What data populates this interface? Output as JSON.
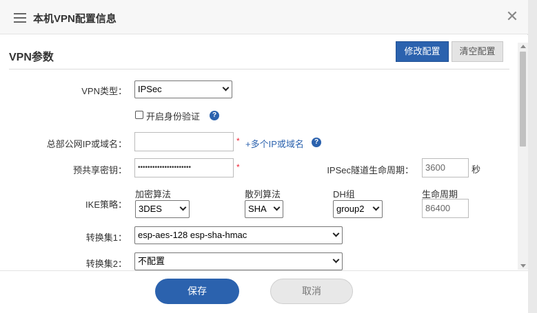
{
  "dialog": {
    "title": "本机VPN配置信息",
    "close_glyph": "✕"
  },
  "section": {
    "title": "VPN参数",
    "modify_label": "修改配置",
    "clear_label": "清空配置"
  },
  "form": {
    "vpn_type_label": "VPN类型：",
    "vpn_type_value": "IPSec",
    "auth_label": "开启身份验证",
    "auth_checked": false,
    "hq_label": "总部公网IP或域名：",
    "hq_value": "",
    "more_ip_label": "+多个IP或域名",
    "psk_label": "预共享密钥：",
    "psk_value": "••••••••••••••••••••••",
    "tunnel_life_label": "IPSec隧道生命周期：",
    "tunnel_life_value": "3600",
    "tunnel_life_unit": "秒",
    "ike_label": "IKE策略：",
    "ike_encrypt_label": "加密算法",
    "ike_encrypt_value": "3DES",
    "ike_hash_label": "散列算法",
    "ike_hash_value": "SHA",
    "ike_dh_label": "DH组",
    "ike_dh_value": "group2",
    "ike_life_label": "生命周期",
    "ike_life_value": "86400",
    "transform1_label": "转换集1：",
    "transform1_value": "esp-aes-128 esp-sha-hmac",
    "transform2_label": "转换集2：",
    "transform2_value": "不配置",
    "required_mark": "*",
    "help_glyph": "?"
  },
  "footer": {
    "save_label": "保存",
    "cancel_label": "取消"
  },
  "colors": {
    "primary": "#2b62ae",
    "required": "#e22233"
  }
}
